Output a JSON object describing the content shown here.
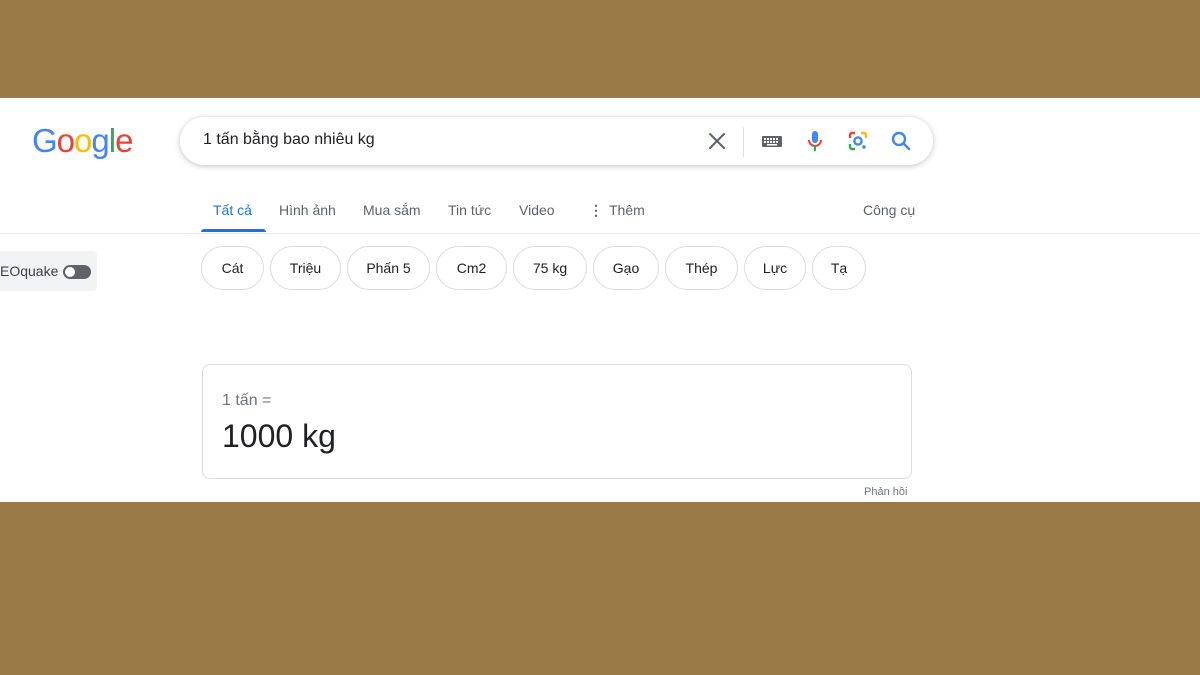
{
  "logo": {
    "letters": [
      "G",
      "o",
      "o",
      "g",
      "l",
      "e"
    ]
  },
  "search": {
    "query": "1 tấn bằng bao nhiêu kg"
  },
  "tabs": [
    {
      "label": "Tất cả"
    },
    {
      "label": "Hình ảnh"
    },
    {
      "label": "Mua sắm"
    },
    {
      "label": "Tin tức"
    },
    {
      "label": "Video"
    },
    {
      "label": "Thêm"
    }
  ],
  "tools_label": "Công cụ",
  "extension": {
    "label": "EOquake"
  },
  "chips": [
    "Cát",
    "Triệu",
    "Phấn 5",
    "Cm2",
    "75 kg",
    "Gạo",
    "Thép",
    "Lực",
    "Tạ"
  ],
  "conversion": {
    "from": "1 tấn =",
    "result": "1000 kg"
  },
  "feedback_label": "Phản hồi",
  "colors": {
    "blue": "#4285f4",
    "red": "#ea4335",
    "yellow": "#fbbc05",
    "green": "#34a853",
    "accent": "#1a73e8",
    "background": "#9a7b47"
  },
  "icons": [
    "clear-icon",
    "keyboard-icon",
    "mic-icon",
    "google-lens-icon",
    "search-icon",
    "more-vert-icon"
  ]
}
